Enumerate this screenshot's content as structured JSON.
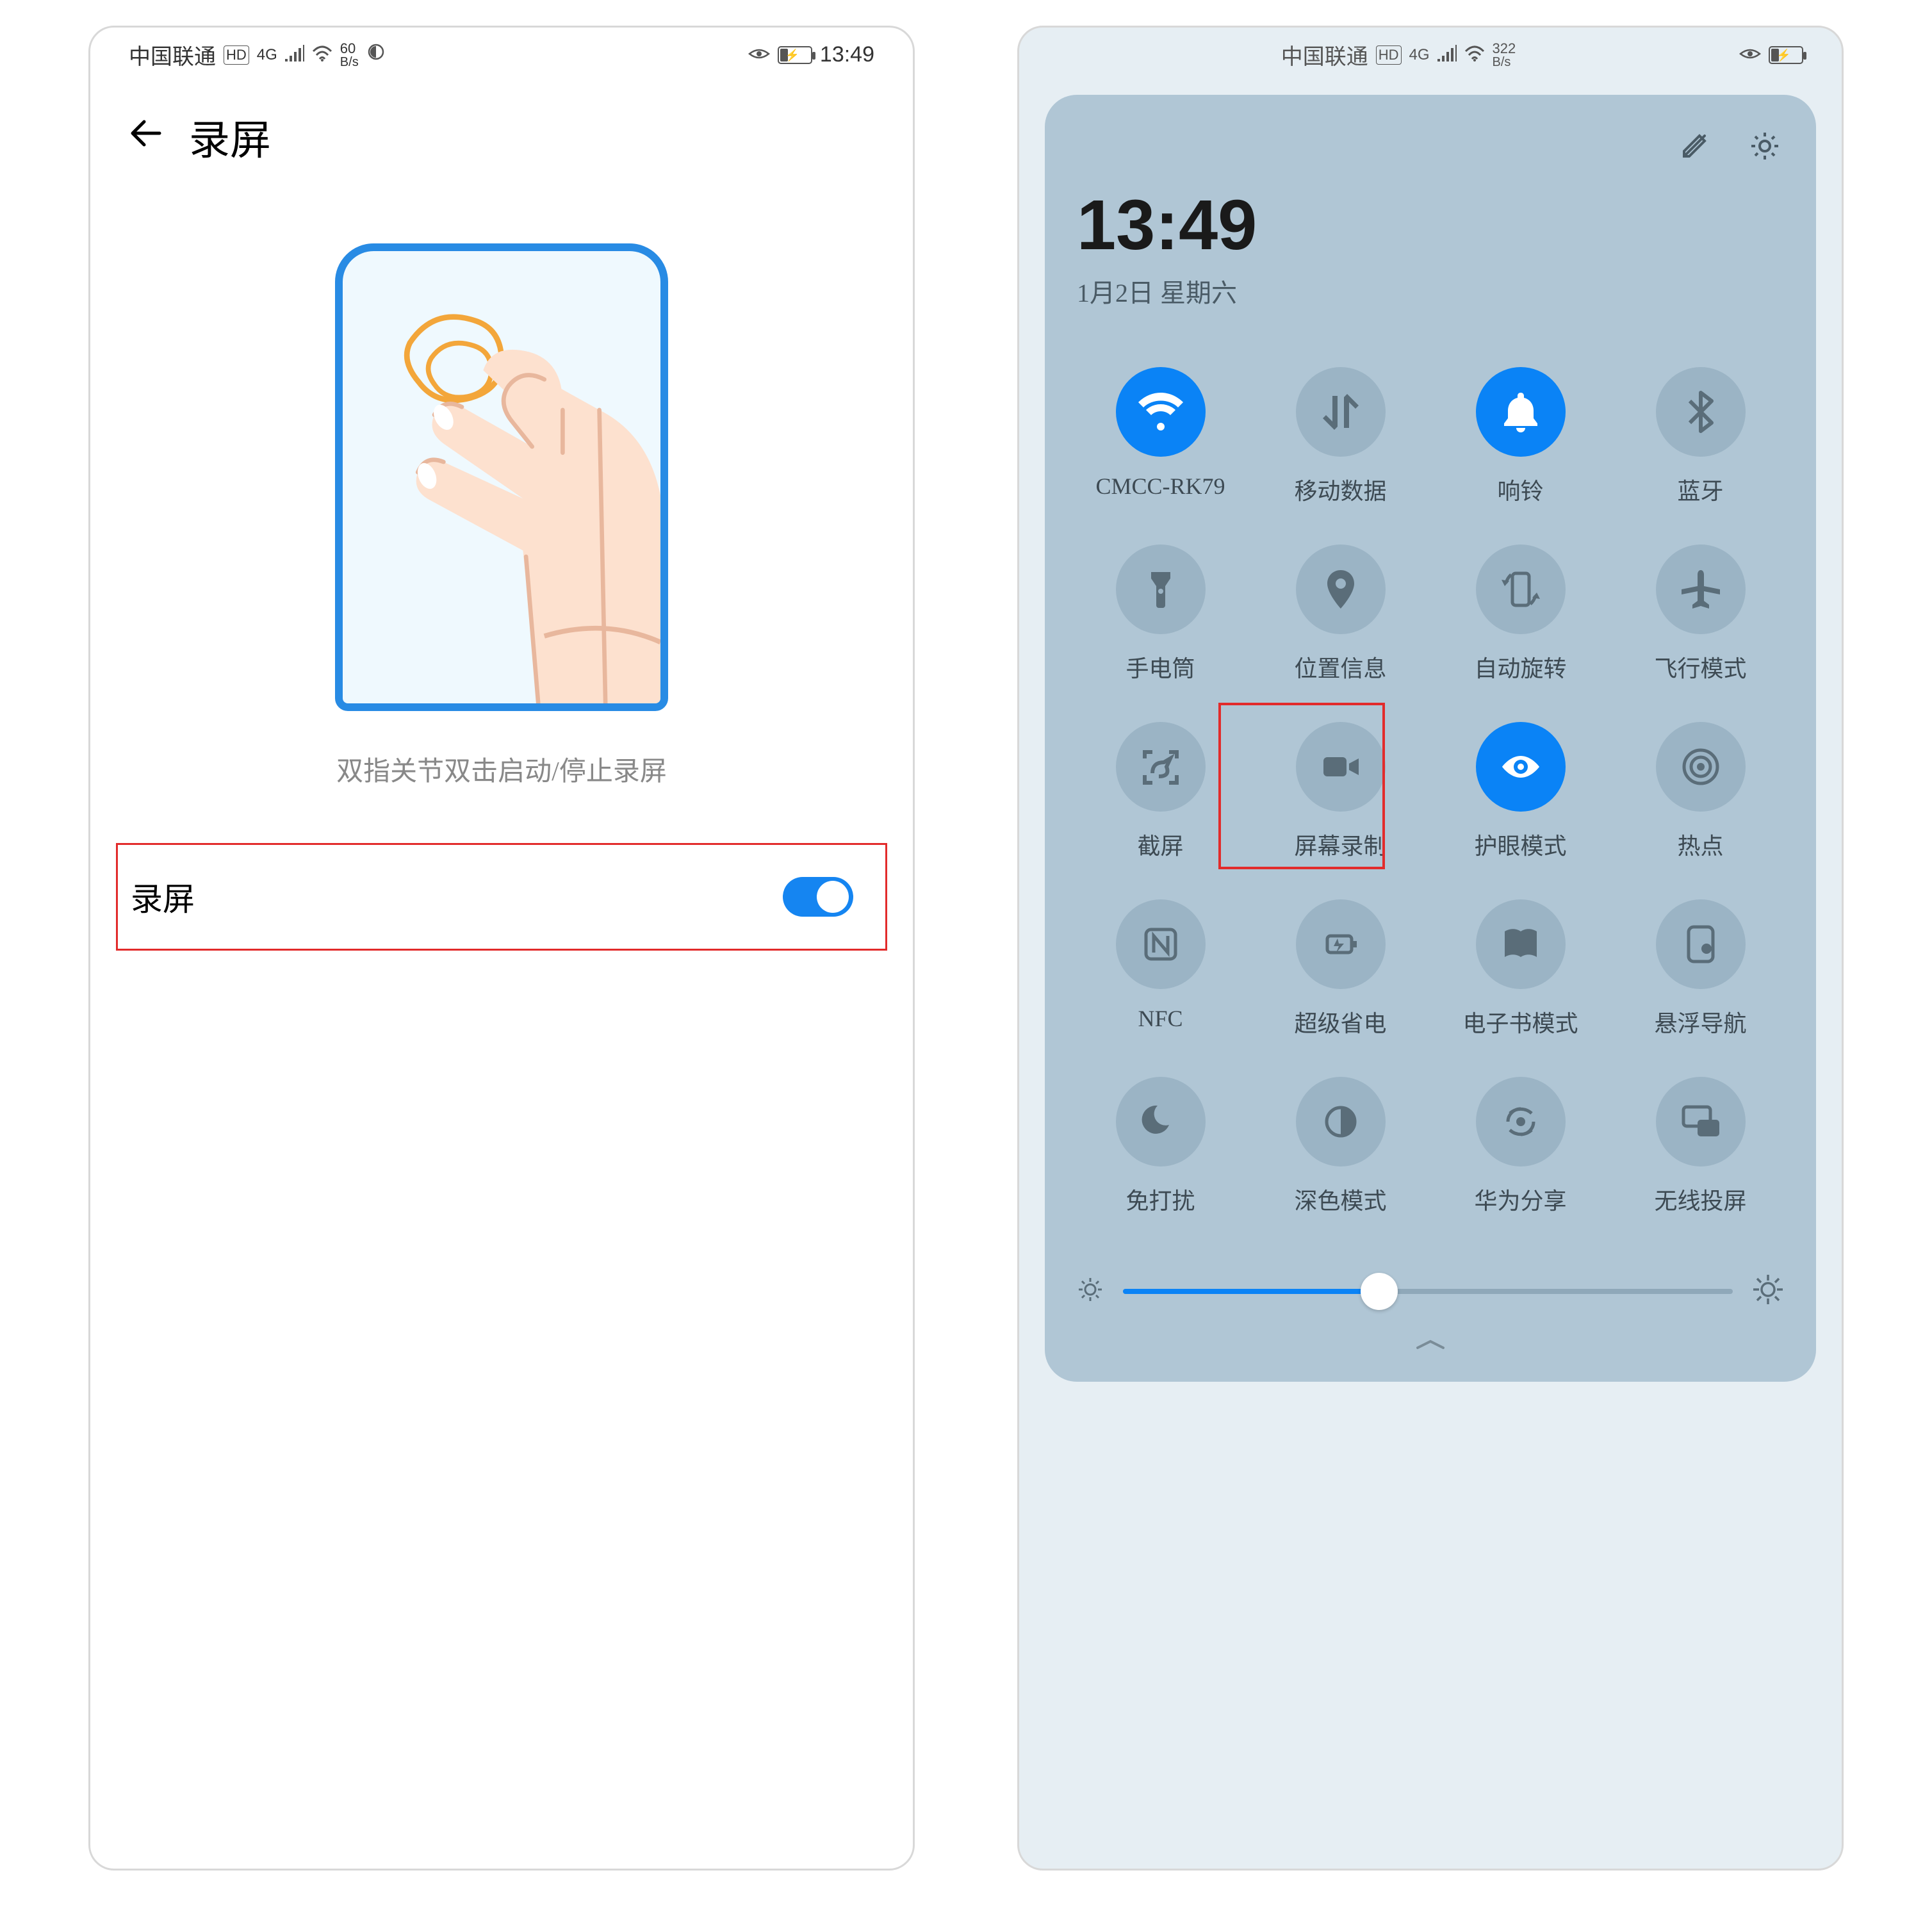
{
  "left": {
    "status": {
      "carrier": "中国联通",
      "speed_value": "60",
      "speed_unit": "B/s",
      "time": "13:49",
      "signal_badge": "HD",
      "net_badge": "4G"
    },
    "title": "录屏",
    "hint": "双指关节双击启动/停止录屏",
    "toggle_label": "录屏",
    "toggle_on": true
  },
  "right": {
    "status": {
      "carrier": "中国联通",
      "speed_value": "322",
      "speed_unit": "B/s",
      "signal_badge": "HD",
      "net_badge": "4G"
    },
    "clock": {
      "time": "13:49",
      "date": "1月2日 星期六"
    },
    "tiles": [
      {
        "label": "CMCC-RK79",
        "icon": "wifi",
        "active": true
      },
      {
        "label": "移动数据",
        "icon": "data",
        "active": false
      },
      {
        "label": "响铃",
        "icon": "bell",
        "active": true
      },
      {
        "label": "蓝牙",
        "icon": "bluetooth",
        "active": false
      },
      {
        "label": "手电筒",
        "icon": "flashlight",
        "active": false
      },
      {
        "label": "位置信息",
        "icon": "location",
        "active": false
      },
      {
        "label": "自动旋转",
        "icon": "rotate",
        "active": false
      },
      {
        "label": "飞行模式",
        "icon": "airplane",
        "active": false
      },
      {
        "label": "截屏",
        "icon": "screenshot",
        "active": false
      },
      {
        "label": "屏幕录制",
        "icon": "screenrecord",
        "active": false,
        "highlight": true
      },
      {
        "label": "护眼模式",
        "icon": "eye",
        "active": true
      },
      {
        "label": "热点",
        "icon": "hotspot",
        "active": false
      },
      {
        "label": "NFC",
        "icon": "nfc",
        "active": false
      },
      {
        "label": "超级省电",
        "icon": "powersave",
        "active": false
      },
      {
        "label": "电子书模式",
        "icon": "ebook",
        "active": false
      },
      {
        "label": "悬浮导航",
        "icon": "floatnav",
        "active": false
      },
      {
        "label": "免打扰",
        "icon": "dnd",
        "active": false
      },
      {
        "label": "深色模式",
        "icon": "dark",
        "active": false
      },
      {
        "label": "华为分享",
        "icon": "share",
        "active": false
      },
      {
        "label": "无线投屏",
        "icon": "cast",
        "active": false
      }
    ],
    "brightness_percent": 42
  }
}
